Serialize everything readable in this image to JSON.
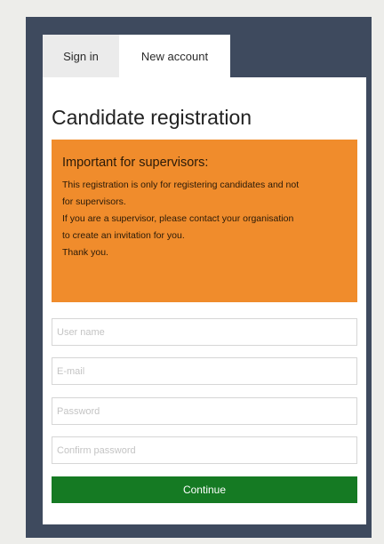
{
  "tabs": {
    "sign_in": "Sign in",
    "new_account": "New account"
  },
  "title": "Candidate registration",
  "notice": {
    "heading": "Important for supervisors:",
    "lines": [
      "This registration is only for registering candidates and not",
      "for supervisors.",
      "If you are a supervisor, please contact your organisation",
      "to create an invitation for you.",
      "Thank you."
    ]
  },
  "form": {
    "username": {
      "placeholder": "User name",
      "value": ""
    },
    "email": {
      "placeholder": "E-mail",
      "value": ""
    },
    "password": {
      "placeholder": "Password",
      "value": ""
    },
    "confirm_password": {
      "placeholder": "Confirm password",
      "value": ""
    },
    "continue_label": "Continue"
  },
  "colors": {
    "frame": "#3e4a5e",
    "notice": "#f08c2c",
    "button": "#157a23"
  }
}
